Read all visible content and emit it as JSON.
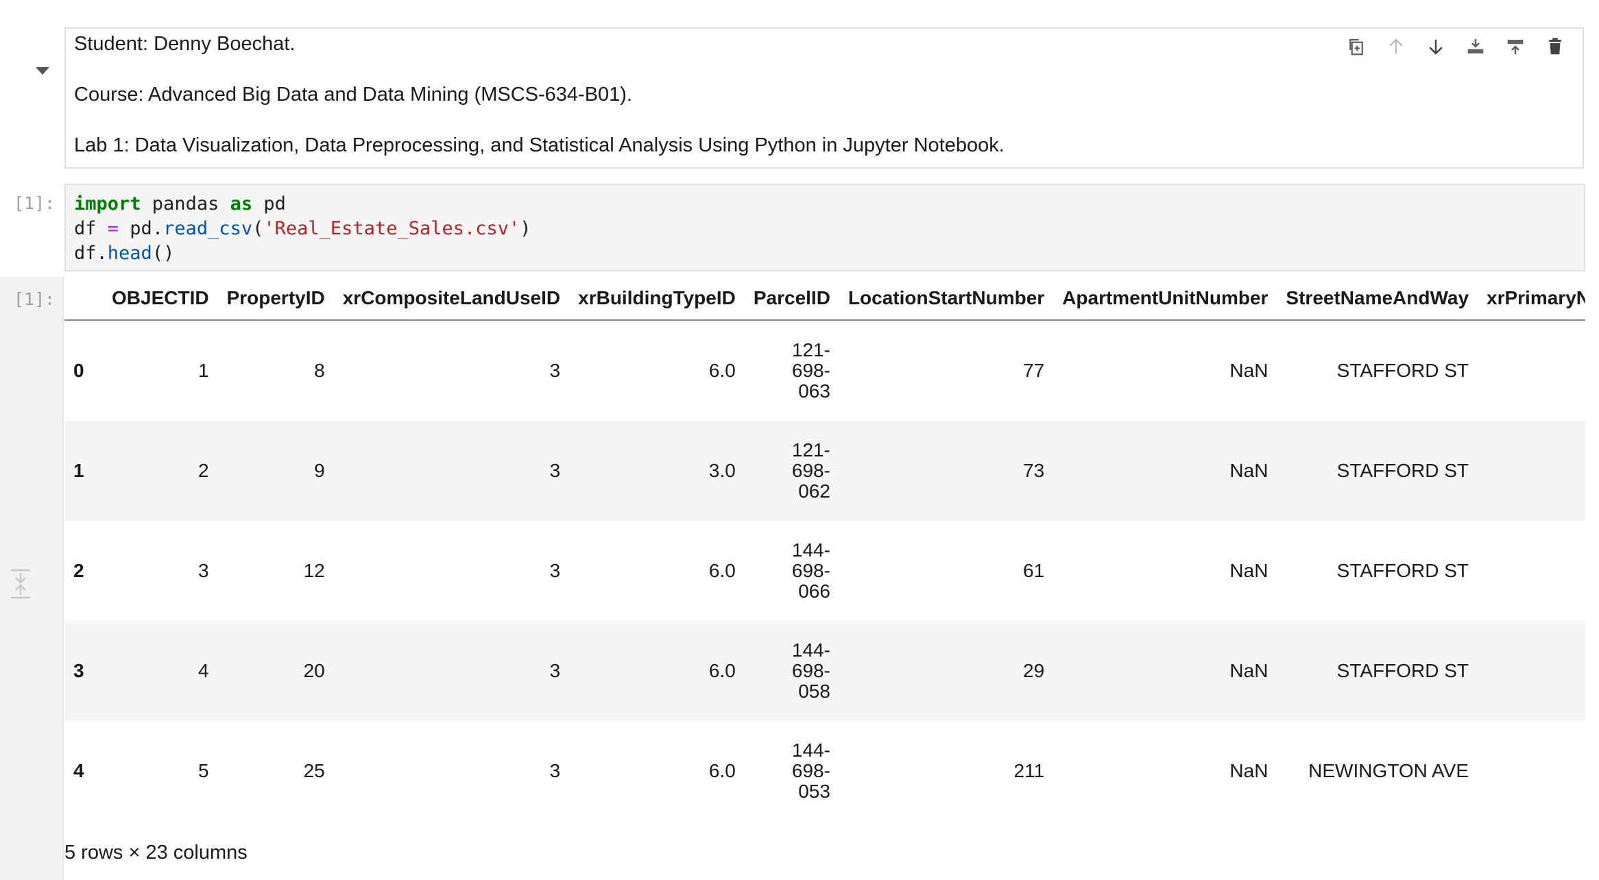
{
  "markdown_cell": {
    "lines": [
      "Student: Denny Boechat.",
      "Course: Advanced Big Data and Data Mining (MSCS-634-B01).",
      "Lab 1: Data Visualization, Data Preprocessing, and Statistical Analysis Using Python in Jupyter Notebook."
    ]
  },
  "toolbar": {
    "icons": [
      "duplicate-icon",
      "move-up-icon",
      "move-down-icon",
      "insert-below-icon",
      "insert-above-icon",
      "delete-icon"
    ]
  },
  "code_cell": {
    "prompt": "[1]:",
    "tokens": {
      "import_kw": "import",
      "pandas_mod": " pandas ",
      "as_kw": "as",
      "pd_alias": " pd",
      "df_var": "df ",
      "eq_op": "=",
      "pd_ref": " pd.",
      "read_csv_fn": "read_csv",
      "open_paren": "(",
      "csv_str": "'Real_Estate_Sales.csv'",
      "close_paren": ")",
      "df_ref": "df.",
      "head_fn": "head",
      "head_parens": "()"
    }
  },
  "output": {
    "prompt": "[1]:",
    "columns": [
      "",
      "OBJECTID",
      "PropertyID",
      "xrCompositeLandUseID",
      "xrBuildingTypeID",
      "ParcelID",
      "LocationStartNumber",
      "ApartmentUnitNumber",
      "StreetNameAndWay",
      "xrPrimaryNeigh"
    ],
    "rows": [
      {
        "index": "0",
        "objectid": "1",
        "propertyid": "8",
        "landuse": "3",
        "buildingtype": "6.0",
        "parcel": [
          "121-",
          "698-",
          "063"
        ],
        "locstart": "77",
        "apt": "NaN",
        "street": "STAFFORD ST",
        "neigh": ""
      },
      {
        "index": "1",
        "objectid": "2",
        "propertyid": "9",
        "landuse": "3",
        "buildingtype": "3.0",
        "parcel": [
          "121-",
          "698-",
          "062"
        ],
        "locstart": "73",
        "apt": "NaN",
        "street": "STAFFORD ST",
        "neigh": ""
      },
      {
        "index": "2",
        "objectid": "3",
        "propertyid": "12",
        "landuse": "3",
        "buildingtype": "6.0",
        "parcel": [
          "144-",
          "698-",
          "066"
        ],
        "locstart": "61",
        "apt": "NaN",
        "street": "STAFFORD ST",
        "neigh": ""
      },
      {
        "index": "3",
        "objectid": "4",
        "propertyid": "20",
        "landuse": "3",
        "buildingtype": "6.0",
        "parcel": [
          "144-",
          "698-",
          "058"
        ],
        "locstart": "29",
        "apt": "NaN",
        "street": "STAFFORD ST",
        "neigh": ""
      },
      {
        "index": "4",
        "objectid": "5",
        "propertyid": "25",
        "landuse": "3",
        "buildingtype": "6.0",
        "parcel": [
          "144-",
          "698-",
          "053"
        ],
        "locstart": "211",
        "apt": "NaN",
        "street": "NEWINGTON AVE",
        "neigh": ""
      }
    ],
    "summary": "5 rows × 23 columns"
  }
}
